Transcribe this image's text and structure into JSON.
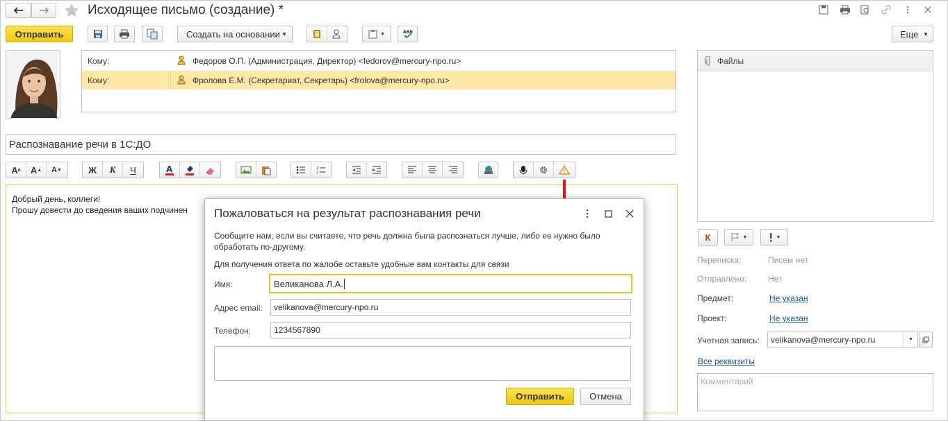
{
  "window": {
    "title": "Исходящее письмо (создание) *",
    "send_label": "Отправить",
    "create_based_on_label": "Создать на основании",
    "more_label": "Еще"
  },
  "recipients": [
    {
      "field_label": "Кому:",
      "value": "Федоров О.П. (Администрация, Директор) <fedorov@mercury-npo.ru>"
    },
    {
      "field_label": "Кому:",
      "value": "Фролова Е.М. (Секретариат, Секретарь) <frolova@mercury-npo.ru>"
    }
  ],
  "subject": "Распознавание речи в 1С:ДО",
  "editor": {
    "toolbar": {
      "bold": "Ж",
      "italic": "К",
      "underline": "Ч"
    },
    "lines": [
      "Добрый день, коллеги!",
      "Прошу довести до сведения ваших подчинен"
    ]
  },
  "files": {
    "title": "Файлы"
  },
  "side": {
    "k_label": "К",
    "rows": [
      {
        "label": "Переписка:",
        "value": "Писем нет"
      },
      {
        "label": "Отправлено:",
        "value": "Нет"
      }
    ],
    "subject_label": "Предмет:",
    "subject_value": "Не указан",
    "project_label": "Проект:",
    "project_value": "Не указан",
    "account_label": "Учетная запись:",
    "account_value": "velikanova@mercury-npo.ru",
    "all_props": "Все реквизиты",
    "comment_placeholder": "Комментарий"
  },
  "dialog": {
    "title": "Пожаловаться на результат распознавания речи",
    "text1": "Сообщите нам, если вы считаете, что речь должна была распознаться лучше, либо ее нужно было обработать по-другому.",
    "text2": "Для получения ответа по жалобе оставьте удобные вам контакты для связи",
    "name_label": "Имя:",
    "name_value": "Великанова Л.А.",
    "email_label": "Адрес email:",
    "email_value": "velikanova@mercury-npo.ru",
    "phone_label": "Телефон:",
    "phone_value": "1234567890",
    "send_label": "Отправить",
    "cancel_label": "Отмена"
  },
  "colors": {
    "accent_yellow": "#f5d21c",
    "selected_row": "#fbe8a6",
    "arrow_red": "#e8151b",
    "link": "#1a55a8"
  }
}
